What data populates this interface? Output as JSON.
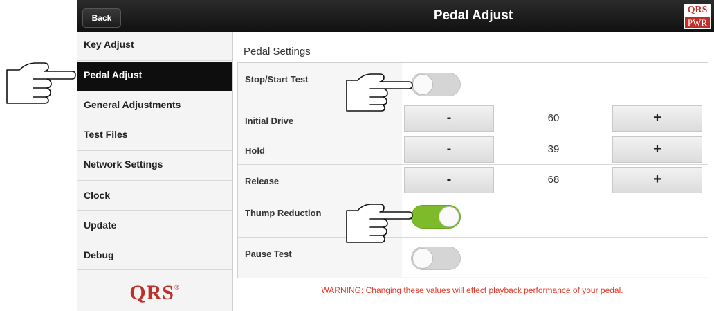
{
  "header": {
    "back_label": "Back",
    "title": "Pedal Adjust",
    "logo_top": "QRS",
    "logo_bottom": "PWR"
  },
  "sidebar": {
    "items": [
      {
        "label": "Key Adjust"
      },
      {
        "label": "Pedal Adjust",
        "active": true
      },
      {
        "label": "General Adjustments"
      },
      {
        "label": "Test Files"
      },
      {
        "label": "Network Settings"
      },
      {
        "label": "Clock"
      },
      {
        "label": "Update"
      },
      {
        "label": "Debug"
      }
    ],
    "logo_text": "QRS",
    "logo_mark": "®"
  },
  "main": {
    "section_title": "Pedal Settings",
    "rows": [
      {
        "label": "Stop/Start Test",
        "type": "toggle",
        "on": false
      },
      {
        "label": "Initial Drive",
        "type": "stepper",
        "value": "60",
        "minus": "-",
        "plus": "+"
      },
      {
        "label": "Hold",
        "type": "stepper",
        "value": "39",
        "minus": "-",
        "plus": "+"
      },
      {
        "label": "Release",
        "type": "stepper",
        "value": "68",
        "minus": "-",
        "plus": "+"
      },
      {
        "label": "Thump Reduction",
        "type": "toggle",
        "on": true
      },
      {
        "label": "Pause Test",
        "type": "toggle",
        "on": false
      }
    ],
    "warning": "WARNING: Changing these values will effect playback performance of your pedal."
  },
  "colors": {
    "accent_red": "#c0302a",
    "toggle_on": "#7dbb2a",
    "warning": "#e23b2c"
  },
  "icons": [
    "pointing-hand-icon"
  ]
}
